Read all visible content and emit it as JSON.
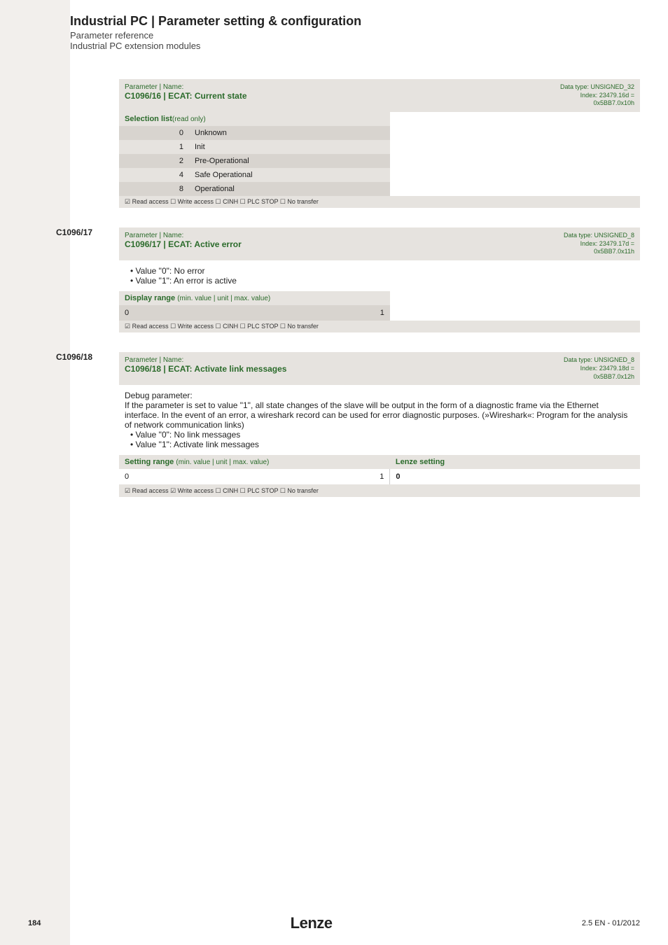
{
  "header": {
    "title": "Industrial PC | Parameter setting & configuration",
    "subtitle1": "Parameter reference",
    "subtitle2": "Industrial PC extension modules"
  },
  "params": [
    {
      "id": "",
      "pn_label": "Parameter | Name:",
      "name": "C1096/16 | ECAT: Current state",
      "dt": [
        "Data type: UNSIGNED_32",
        "Index: 23479.16d =",
        "0x5BB7.0x10h"
      ],
      "selection_label": "Selection list",
      "selection_suffix": "(read only)",
      "selection": [
        {
          "n": "0",
          "v": "Unknown"
        },
        {
          "n": "1",
          "v": "Init"
        },
        {
          "n": "2",
          "v": "Pre-Operational"
        },
        {
          "n": "4",
          "v": "Safe Operational"
        },
        {
          "n": "8",
          "v": "Operational"
        }
      ],
      "access": "☑ Read access   ☐ Write access   ☐ CINH   ☐ PLC STOP   ☐ No transfer"
    },
    {
      "id": "C1096/17",
      "pn_label": "Parameter | Name:",
      "name": "C1096/17 | ECAT: Active error",
      "dt": [
        "Data type: UNSIGNED_8",
        "Index: 23479.17d =",
        "0x5BB7.0x11h"
      ],
      "desc_items": [
        "Value \"0\": No error",
        "Value \"1\": An error is active"
      ],
      "range_label": "Display range",
      "range_suffix": "(min. value | unit | max. value)",
      "range": {
        "min": "0",
        "unit": "",
        "max": "1"
      },
      "access": "☑ Read access   ☐ Write access   ☐ CINH   ☐ PLC STOP   ☐ No transfer"
    },
    {
      "id": "C1096/18",
      "pn_label": "Parameter | Name:",
      "name": "C1096/18 | ECAT: Activate link messages",
      "dt": [
        "Data type: UNSIGNED_8",
        "Index: 23479.18d =",
        "0x5BB7.0x12h"
      ],
      "desc_intro": "Debug parameter:",
      "desc_para": "If the parameter is set to value \"1\", all state changes of the slave will be output in the form of a diagnostic frame via the Ethernet interface. In the event of an error, a wireshark record can be used for error diagnostic purposes. (»Wireshark«: Program for the analysis of network communication links)",
      "desc_items": [
        "Value \"0\": No link messages",
        "Value \"1\": Activate link messages"
      ],
      "range_label": "Setting range",
      "range_suffix": "(min. value | unit | max. value)",
      "lenze_label": "Lenze setting",
      "range": {
        "min": "0",
        "unit": "",
        "max": "1",
        "lenze": "0"
      },
      "access": "☑ Read access   ☑ Write access   ☐ CINH   ☐ PLC STOP   ☐ No transfer"
    }
  ],
  "footer": {
    "page": "184",
    "brand": "Lenze",
    "rev": "2.5 EN - 01/2012"
  }
}
